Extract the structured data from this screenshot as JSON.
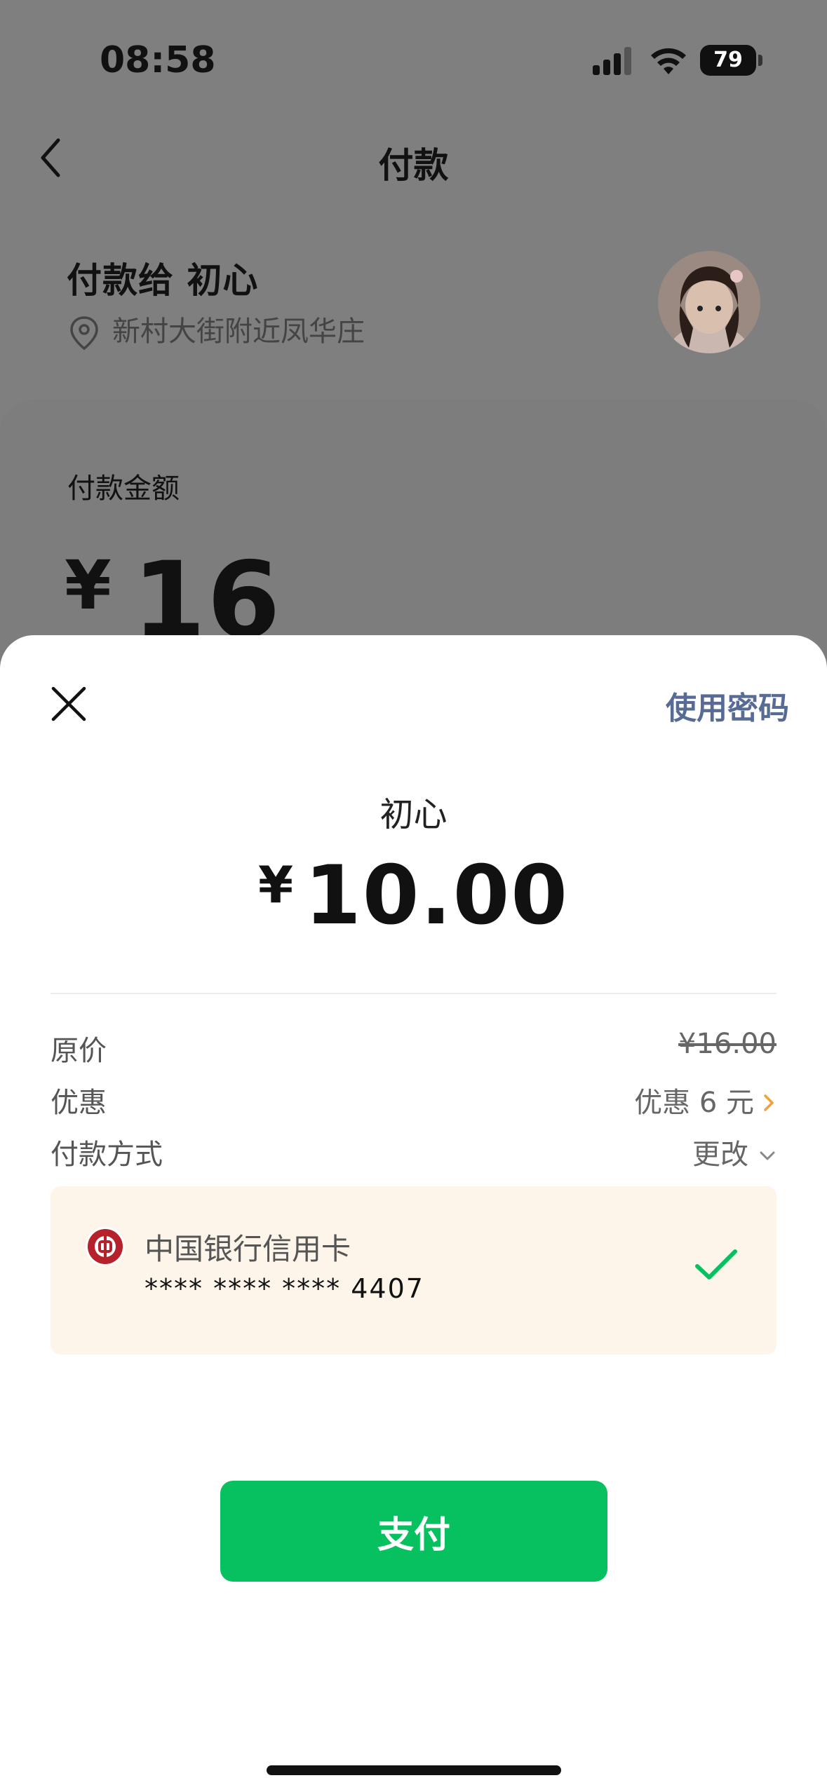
{
  "status_bar": {
    "time": "08:58",
    "battery": "79"
  },
  "header": {
    "title": "付款"
  },
  "payee": {
    "label": "付款给 初心",
    "location": "新村大街附近凤华庄"
  },
  "amount_section": {
    "label": "付款金额",
    "currency": "¥",
    "value": "16"
  },
  "sheet": {
    "use_password": "使用密码",
    "merchant_name": "初心",
    "currency": "¥",
    "pay_amount": "10.00",
    "original_price_label": "原价",
    "original_price_value": "¥16.00",
    "discount_label": "优惠",
    "discount_value": "优惠 6 元",
    "payment_method_label": "付款方式",
    "change_label": "更改",
    "card_name": "中国银行信用卡",
    "card_number": "**** **** **** 4407",
    "pay_button": "支付"
  },
  "colors": {
    "accent_green": "#07c160",
    "link_blue": "#576b95",
    "discount_orange": "#f0a13b",
    "card_bg": "#fdf5ea",
    "boc_red": "#b5222b"
  },
  "icons": [
    "back-icon",
    "location-icon",
    "close-icon",
    "chevron-right-icon",
    "chevron-down-icon",
    "bank-of-china-icon",
    "check-icon",
    "signal-icon",
    "wifi-icon"
  ]
}
